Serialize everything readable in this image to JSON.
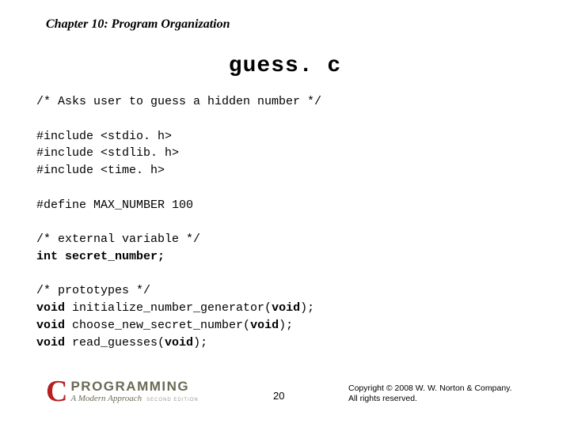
{
  "header": "Chapter 10: Program Organization",
  "title": "guess. c",
  "code": {
    "l1": "/* Asks user to guess a hidden number */",
    "l2": "#include <stdio. h>",
    "l3": "#include <stdlib. h>",
    "l4": "#include <time. h>",
    "l5": "#define MAX_NUMBER 100",
    "l6": "/* external variable */",
    "l7a": "int",
    "l7b": " secret_number;",
    "l8": "/* prototypes */",
    "l9a": "void",
    "l9b": " initialize_number_generator(",
    "l9c": "void",
    "l9d": ");",
    "l10a": "void",
    "l10b": " choose_new_secret_number(",
    "l10c": "void",
    "l10d": ");",
    "l11a": "void",
    "l11b": " read_guesses(",
    "l11c": "void",
    "l11d": ");"
  },
  "logo": {
    "c": "C",
    "prog": "PROGRAMMING",
    "sub": "A Modern Approach",
    "ed": "SECOND EDITION"
  },
  "pagenum": "20",
  "copyright": {
    "line1": "Copyright © 2008 W. W. Norton & Company.",
    "line2": "All rights reserved."
  }
}
